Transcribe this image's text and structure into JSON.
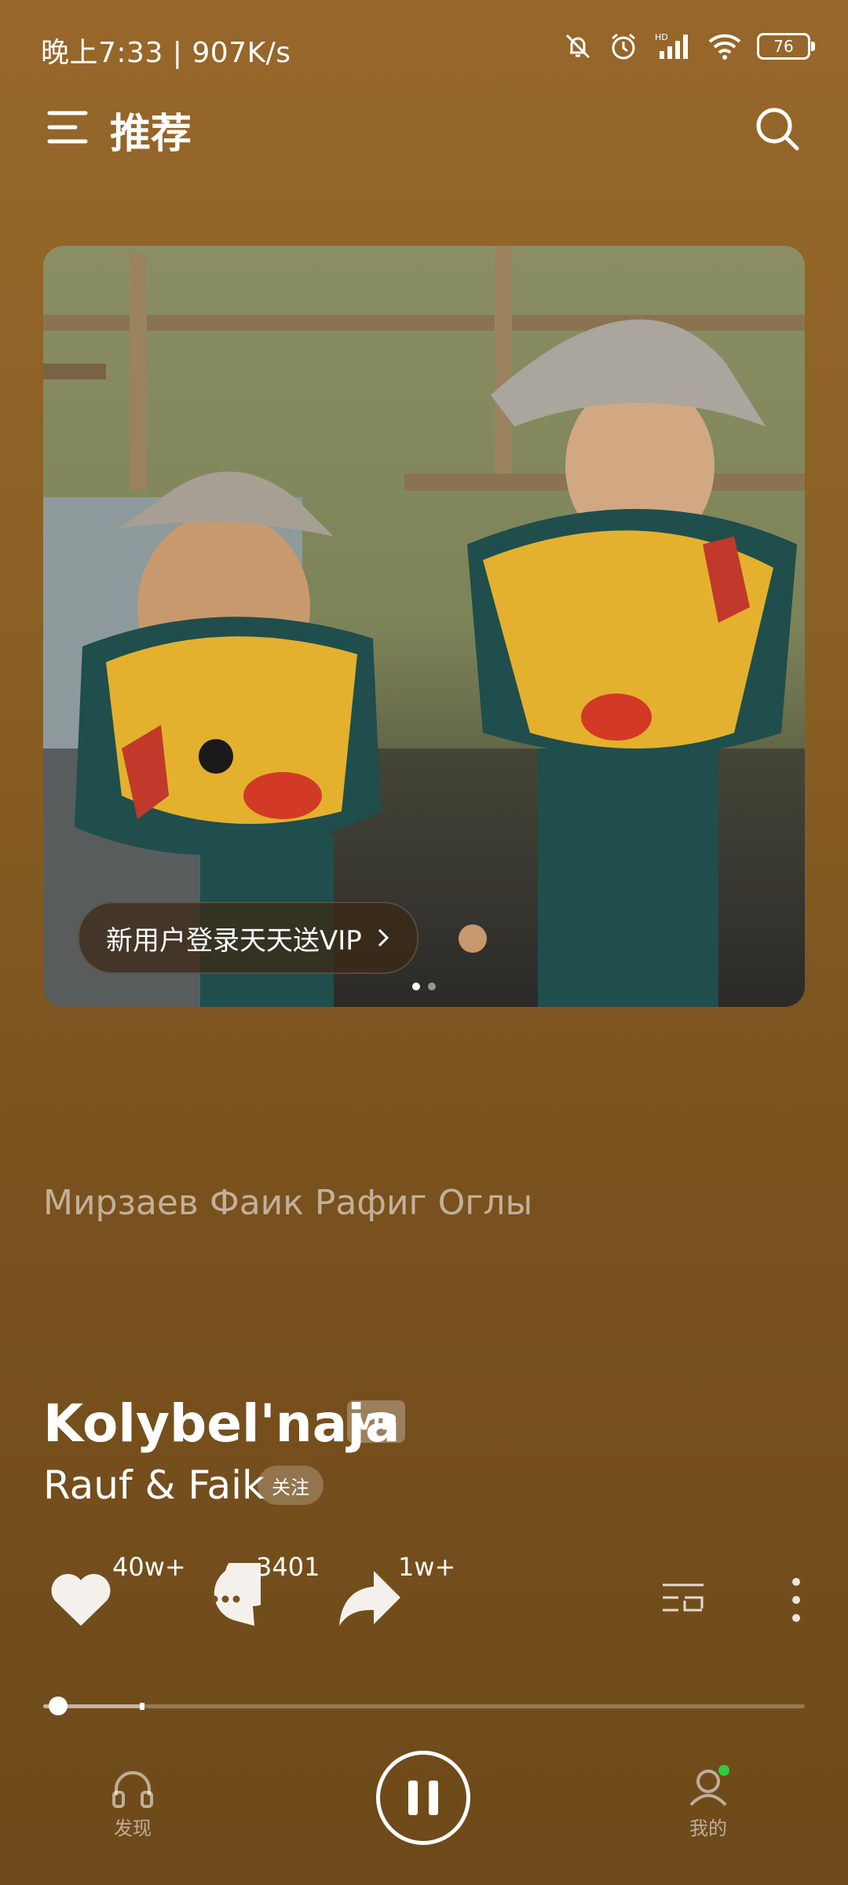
{
  "status_bar": {
    "time": "晚上7:33 | 907K/s",
    "battery": "76"
  },
  "header": {
    "title": "推荐"
  },
  "banner": {
    "promo_text": "新用户登录天天送VIP",
    "page_count": 2,
    "active_page": 1
  },
  "lyric_line": "Мирзаев Фаик Рафиг Оглы",
  "song": {
    "title": "Kolybel'naja",
    "badge": "VIP",
    "artist": "Rauf & Faik",
    "follow_label": "关注"
  },
  "actions": {
    "likes": "40w+",
    "comments": "3401",
    "shares": "1w+"
  },
  "playback": {
    "progress_fraction": 0.02,
    "buffer_fraction": 0.13,
    "state": "playing"
  },
  "bottom_nav": {
    "discover_label": "发现",
    "mine_label": "我的"
  },
  "colors": {
    "background_top": "#97672a",
    "background_bottom": "#6e4a1a",
    "notification_dot": "#2ecc40"
  }
}
